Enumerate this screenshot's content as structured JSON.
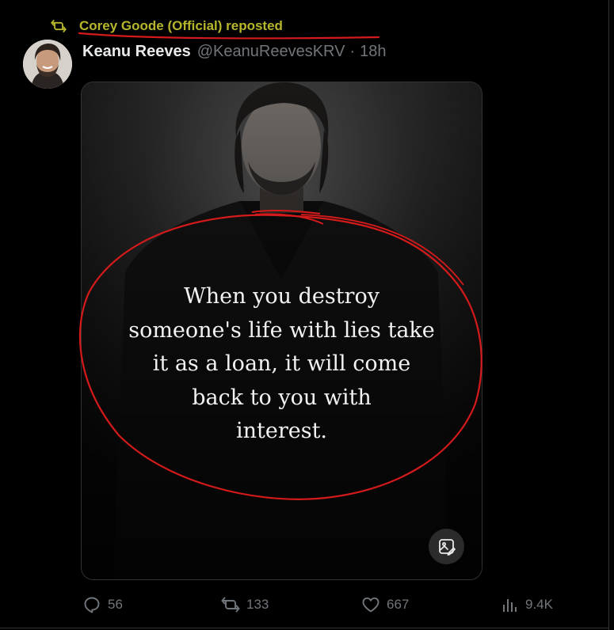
{
  "repost": {
    "text": "Corey Goode (Official) reposted",
    "icon": "repost-icon",
    "color": "#b5b62d"
  },
  "author": {
    "name": "Keanu Reeves",
    "handle": "@KeanuReevesKRV",
    "separator": "·",
    "time": "18h"
  },
  "media": {
    "quote_lines": [
      "When you destroy",
      "someone's life with lies take",
      "it as a loan, it will come",
      "back to you with",
      "interest."
    ],
    "alt_button_icon": "image-description-icon"
  },
  "actions": {
    "replies": "56",
    "reposts": "133",
    "likes": "667",
    "views": "9.4K"
  },
  "annotation_color": "#d41a1a"
}
